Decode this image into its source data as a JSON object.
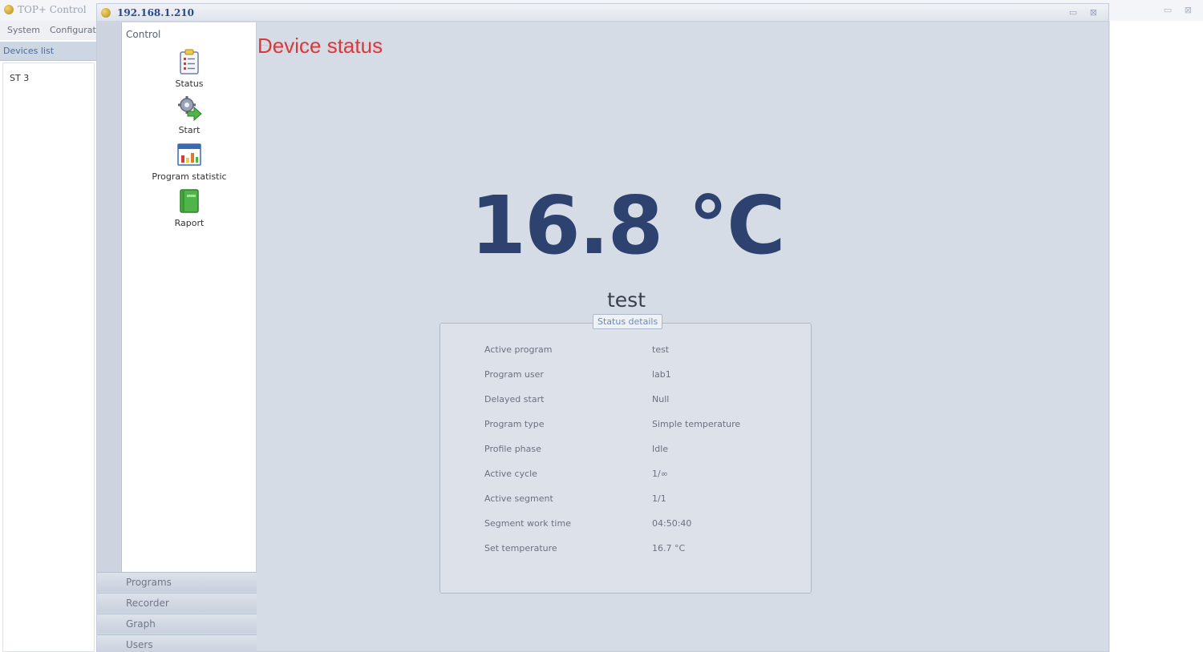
{
  "app": {
    "title": "TOP+ Control",
    "menu": [
      "System",
      "Configurat"
    ],
    "devices_header": "Devices list",
    "devices": [
      "ST 3"
    ]
  },
  "window": {
    "title": "192.168.1.210"
  },
  "nav": {
    "section_title": "Control",
    "items": [
      {
        "label": "Status",
        "icon": "clipboard-icon"
      },
      {
        "label": "Start",
        "icon": "gear-arrow-icon"
      },
      {
        "label": "Program statistic",
        "icon": "bar-chart-icon"
      },
      {
        "label": "Raport",
        "icon": "book-icon"
      }
    ],
    "bottom_tabs": [
      "Programs",
      "Recorder",
      "Graph",
      "Users"
    ]
  },
  "main": {
    "title": "Device status",
    "temperature": "16.8 °C",
    "device_name": "test",
    "details": {
      "legend": "Status details",
      "rows": [
        {
          "key": "Active program",
          "value": "test"
        },
        {
          "key": "Program user",
          "value": "lab1"
        },
        {
          "key": "Delayed start",
          "value": "Null"
        },
        {
          "key": "Program type",
          "value": "Simple temperature"
        },
        {
          "key": "Profile phase",
          "value": "Idle"
        },
        {
          "key": "Active cycle",
          "value": "1/∞"
        },
        {
          "key": "Active segment",
          "value": "1/1"
        },
        {
          "key": "Segment work time",
          "value": "04:50:40"
        },
        {
          "key": "Set temperature",
          "value": "16.7 °C"
        }
      ]
    }
  },
  "colors": {
    "title_red": "#d63a3a",
    "temperature_blue": "#2e4270",
    "link_blue": "#4a6a9a"
  }
}
